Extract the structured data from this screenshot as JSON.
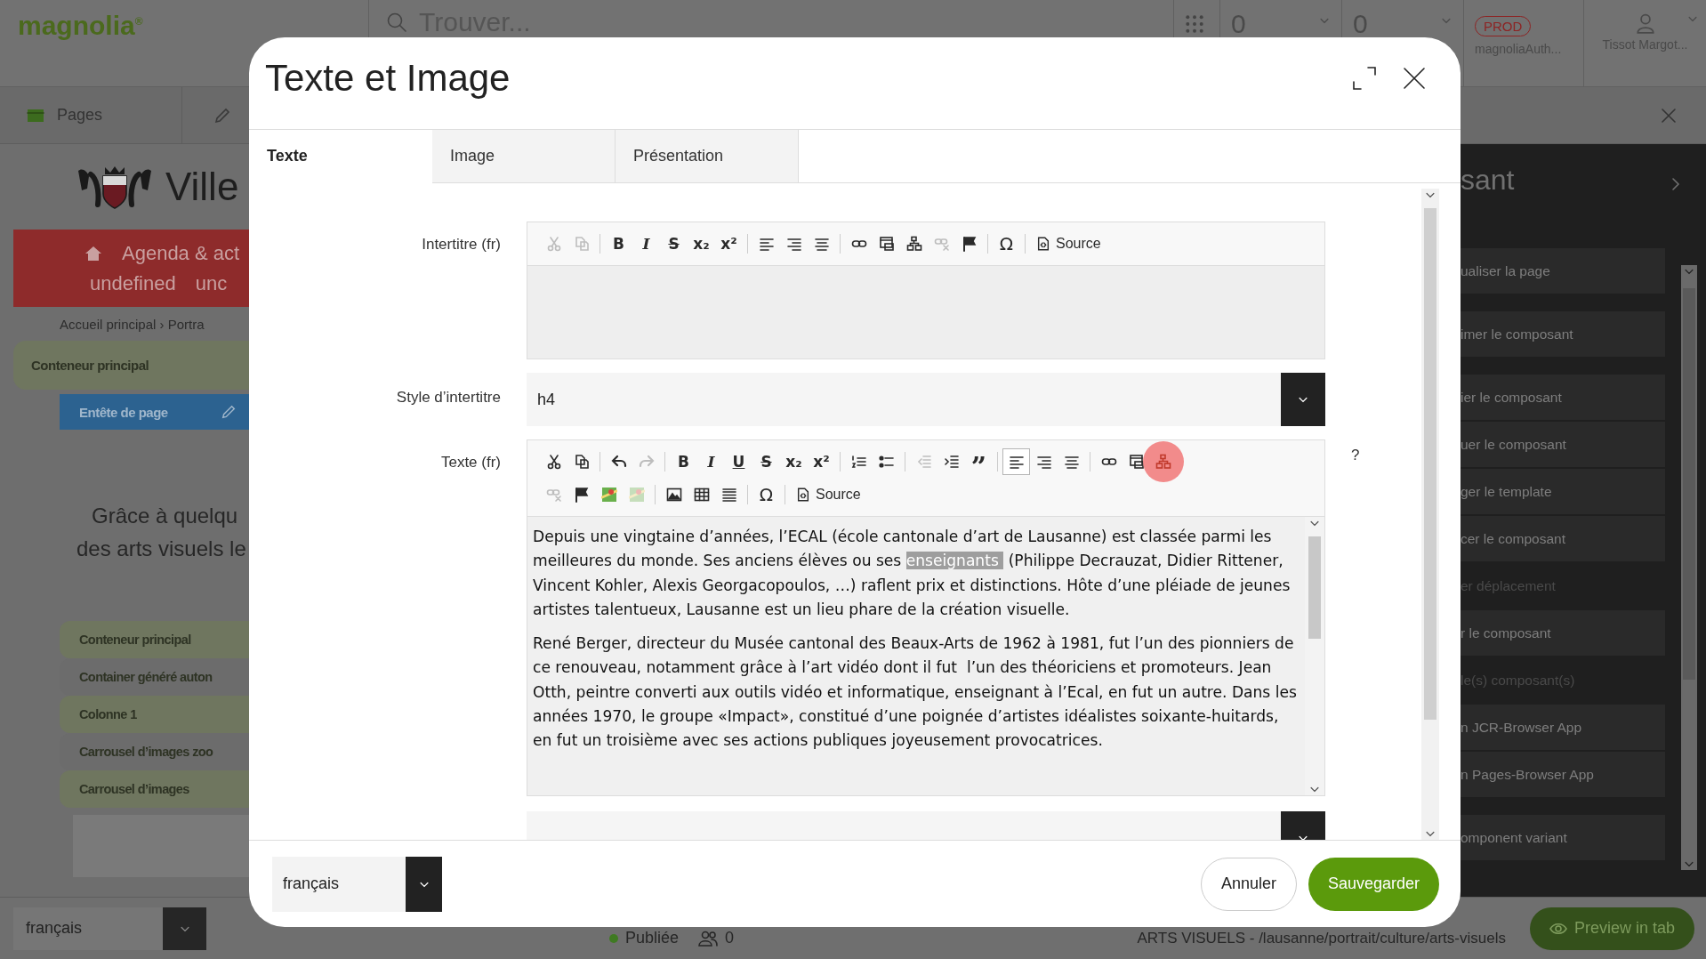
{
  "top_bar": {
    "logo": "magnolia$^{®}$",
    "search": {
      "placeholder": "Trouver..."
    },
    "counters": [
      "0",
      "0"
    ],
    "environment": "PROD",
    "account": "magnoliaAuth...",
    "user": "Tissot Margot..."
  },
  "app_bar": {
    "app": "Pages"
  },
  "page_preview": {
    "site_name": "Ville",
    "nav_rows": [
      [
        "Agenda & act"
      ],
      [
        "undefined",
        "unc"
      ]
    ],
    "breadcrumb": "Accueil principal › Portra",
    "main_area": "Conteneur principal",
    "header_component": "Entête de page",
    "intro_lines": [
      "Grâce à quelqu",
      "des arts visuels le"
    ],
    "components": [
      "Conteneur principal",
      "Container généré auton",
      "Colonne 1",
      "Carrousel d’images zoo",
      "Carrousel d’images"
    ]
  },
  "actions_panel": {
    "title": "sant",
    "items": [
      {
        "label": "ualiser la page",
        "disabled": false
      },
      {
        "label": "imer le composant",
        "disabled": false
      },
      {
        "label": "ier le composant",
        "disabled": false
      },
      {
        "label": "uer le composant",
        "disabled": false
      },
      {
        "label": "ger le template",
        "disabled": false
      },
      {
        "label": "cer le composant",
        "disabled": false
      },
      {
        "label": "er déplacement",
        "disabled": true
      },
      {
        "label": "r le composant",
        "disabled": false
      },
      {
        "label": "le(s) composant(s)",
        "disabled": true
      },
      {
        "label": "n JCR-Browser App",
        "disabled": false
      },
      {
        "label": "n Pages-Browser App",
        "disabled": false
      },
      {
        "label": "omponent variant",
        "disabled": false
      }
    ]
  },
  "status_bar": {
    "language": "français",
    "status": "Publiée",
    "users": "0",
    "path": "ARTS VISUELS - /lausanne/portrait/culture/arts-visuels",
    "preview": "Preview in tab"
  },
  "dialog": {
    "title": "Texte et Image",
    "tabs": [
      {
        "label": "Texte",
        "selected": true
      },
      {
        "label": "Image",
        "selected": false
      },
      {
        "label": "Présentation",
        "selected": false
      }
    ],
    "fields": [
      {
        "kind": "richtext",
        "label": "Intertitre (fr)",
        "toolbar": [
          [
            {
              "kind": "cut",
              "disabled": true
            },
            {
              "kind": "copy",
              "disabled": true
            },
            {
              "kind": "separator"
            },
            {
              "kind": "bold",
              "text": "B",
              "disabled": false
            },
            {
              "kind": "italic",
              "text": "I",
              "disabled": false
            },
            {
              "kind": "strike",
              "text": "S",
              "disabled": false
            },
            {
              "kind": "subscript",
              "text": "x₂",
              "disabled": false
            },
            {
              "kind": "superscript",
              "text": "x²",
              "disabled": false
            },
            {
              "kind": "separator"
            },
            {
              "kind": "align-left",
              "disabled": false
            },
            {
              "kind": "align-right",
              "disabled": false
            },
            {
              "kind": "align-center",
              "disabled": false
            },
            {
              "kind": "separator"
            },
            {
              "kind": "link",
              "disabled": false
            },
            {
              "kind": "iframe",
              "disabled": false
            },
            {
              "kind": "anchor",
              "disabled": false
            },
            {
              "kind": "unlink",
              "disabled": true
            },
            {
              "kind": "flag",
              "disabled": false
            },
            {
              "kind": "separator"
            },
            {
              "kind": "omega",
              "text": "Ω",
              "disabled": false
            },
            {
              "kind": "separator"
            },
            {
              "kind": "source",
              "text": "Source",
              "disabled": false
            }
          ]
        ]
      },
      {
        "kind": "select",
        "label": "Style d’intertitre",
        "value": "h4"
      },
      {
        "kind": "richtext",
        "label": "Texte (fr)",
        "help": "?",
        "toolbar": [
          [
            {
              "kind": "cut",
              "disabled": false,
              "on": false,
              "clicked": false
            },
            {
              "kind": "copy",
              "disabled": false,
              "on": false,
              "clicked": false
            },
            {
              "kind": "separator"
            },
            {
              "kind": "undo",
              "disabled": false,
              "on": false,
              "clicked": false
            },
            {
              "kind": "redo",
              "disabled": true,
              "on": false,
              "clicked": false
            },
            {
              "kind": "separator"
            },
            {
              "kind": "bold",
              "text": "B",
              "disabled": false,
              "on": false,
              "clicked": false
            },
            {
              "kind": "italic",
              "text": "I",
              "disabled": false,
              "on": false,
              "clicked": false
            },
            {
              "kind": "underline",
              "text": "U",
              "disabled": false,
              "on": false,
              "clicked": false
            },
            {
              "kind": "strike",
              "text": "S",
              "disabled": false,
              "on": false,
              "clicked": false
            },
            {
              "kind": "subscript",
              "text": "x₂",
              "disabled": false,
              "on": false,
              "clicked": false
            },
            {
              "kind": "superscript",
              "text": "x²",
              "disabled": false,
              "on": false,
              "clicked": false
            },
            {
              "kind": "separator"
            },
            {
              "kind": "ol",
              "disabled": false,
              "on": false,
              "clicked": false
            },
            {
              "kind": "ul",
              "disabled": false,
              "on": false,
              "clicked": false
            },
            {
              "kind": "separator"
            },
            {
              "kind": "outdent",
              "disabled": true,
              "on": false,
              "clicked": false
            },
            {
              "kind": "indent",
              "disabled": false,
              "on": false,
              "clicked": false
            },
            {
              "kind": "quote",
              "text": "”",
              "disabled": false,
              "on": false,
              "clicked": false
            },
            {
              "kind": "separator"
            },
            {
              "kind": "align-left",
              "disabled": false,
              "on": true,
              "clicked": false
            },
            {
              "kind": "align-right",
              "disabled": false,
              "on": false,
              "clicked": false
            },
            {
              "kind": "align-center",
              "disabled": false,
              "on": false,
              "clicked": false
            },
            {
              "kind": "separator"
            },
            {
              "kind": "link",
              "disabled": false,
              "on": false,
              "clicked": false
            },
            {
              "kind": "iframe",
              "disabled": false,
              "on": false,
              "clicked": false
            },
            {
              "kind": "anchor",
              "disabled": false,
              "on": false,
              "clicked": true
            }
          ],
          [
            {
              "kind": "unlink",
              "disabled": true,
              "on": false,
              "clicked": false
            },
            {
              "kind": "flag",
              "disabled": false,
              "on": false,
              "clicked": false
            },
            {
              "kind": "map",
              "disabled": false,
              "on": false,
              "clicked": false
            },
            {
              "kind": "map",
              "disabled": true,
              "on": false,
              "clicked": false
            },
            {
              "kind": "separator"
            },
            {
              "kind": "image",
              "disabled": false,
              "on": false,
              "clicked": false
            },
            {
              "kind": "table",
              "disabled": false,
              "on": false,
              "clicked": false
            },
            {
              "kind": "hr",
              "disabled": false,
              "on": false,
              "clicked": false
            },
            {
              "kind": "separator"
            },
            {
              "kind": "omega",
              "text": "Ω",
              "disabled": false,
              "on": false,
              "clicked": false
            },
            {
              "kind": "separator"
            },
            {
              "kind": "source",
              "text": "Source",
              "disabled": false,
              "on": false,
              "clicked": false
            }
          ]
        ],
        "paragraphs": [
          [
            {
              "text": "Depuis une vingtaine d’années, l’ECAL (école cantonale d’art de Lausanne) est classée parmi les meilleures du monde. Ses anciens élèves ou ses ",
              "selected": false
            },
            {
              "text": "enseignants ",
              "selected": true
            },
            {
              "text": " (Philippe Decrauzat, Didier Rittener, Vincent Kohler, Alexis Georgacopoulos, …) raflent prix et distinctions. Hôte d’une pléiade de jeunes artistes talentueux, Lausanne est un lieu phare de la création visuelle.",
              "selected": false
            }
          ],
          [
            {
              "text": "René Berger, directeur du Musée cantonal des Beaux-Arts de 1962 à 1981, fut l’un des pionniers de ce renouveau, notamment grâce à l’art vidéo dont il fut  l’un des théoriciens et promoteurs. Jean Otth, peintre converti aux outils vidéo et informatique, enseignant à l’Ecal, en fut un autre. Dans les années 1970, le groupe «Impact», constitué d’une poignée d’artistes idéalistes soixante-huitards, en fut un troisième avec ses actions publiques joyeusement provocatrices.",
              "selected": false
            }
          ]
        ]
      },
      {
        "kind": "select"
      }
    ],
    "footer": {
      "language": "français",
      "buttons": [
        {
          "label": "Annuler",
          "kind": "secondary"
        },
        {
          "label": "Sauvegarder",
          "kind": "primary"
        }
      ]
    }
  }
}
